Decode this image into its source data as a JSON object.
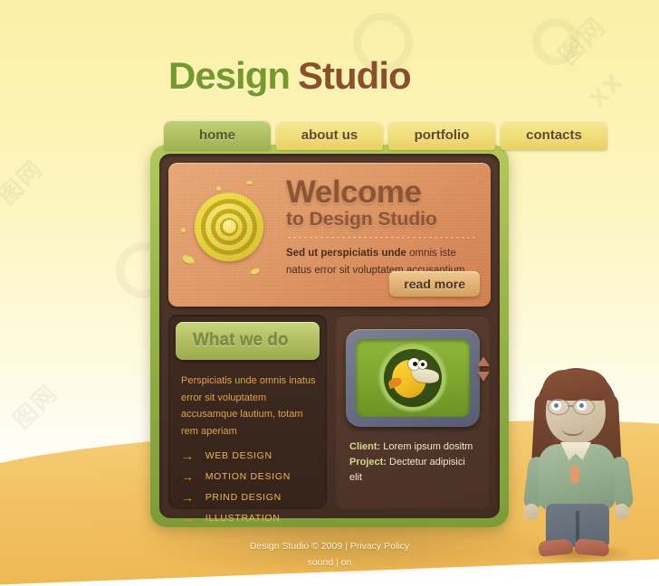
{
  "header": {
    "title_part1": "Design",
    "title_part2": "Studio"
  },
  "nav": {
    "items": [
      {
        "label": "home",
        "active": true
      },
      {
        "label": "about us",
        "active": false
      },
      {
        "label": "portfolio",
        "active": false
      },
      {
        "label": "contacts",
        "active": false
      }
    ]
  },
  "welcome": {
    "heading_line1": "Welcome",
    "heading_line2": "to Design Studio",
    "lead_bold": "Sed ut perspiciatis unde",
    "lead_rest": " omnis iste natus error sit voluptatem accusantium...",
    "button_label": "read more",
    "icon": "spiral-icon"
  },
  "what_we_do": {
    "heading": "What we do",
    "paragraph": "Perspiciatis unde omnis inatus error sit voluptatem accusamque lautium, totam rem aperiam",
    "services": [
      "WEB DESIGN",
      "MOTION DESIGN",
      "PRIND DESIGN",
      "ILLUSTRATION"
    ],
    "bullet_glyph": "→"
  },
  "showcase": {
    "image_alt": "bird-character-illustration",
    "client_label": "Client:",
    "client_value": "Lorem ipsum dositm",
    "project_label": "Project:",
    "project_value": "Dectetur adipisici elit",
    "tv_button_up": "scroll-up",
    "tv_button_down": "scroll-down"
  },
  "footer": {
    "copyright": "Design Studio  © 2009 | Privacy Policy",
    "sound_label": "sound | on"
  },
  "colors": {
    "title_green": "#76992f",
    "title_brown": "#8a4f2b",
    "frame_green": "#9cb74c",
    "panel_brown": "#4b3227",
    "welcome_orange": "#e09a68",
    "accent_orange": "#f08a22",
    "service_text": "#f0b55c",
    "floor_gold": "#f2c264"
  }
}
